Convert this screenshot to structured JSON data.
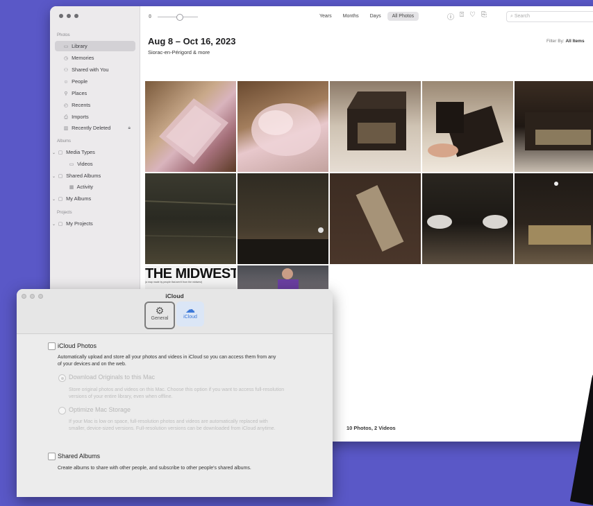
{
  "photos": {
    "sidebar": {
      "sections": {
        "photos": "Photos",
        "albums": "Albums",
        "projects": "Projects"
      },
      "items": [
        {
          "label": "Library",
          "icon": "library-icon",
          "glyph": "▭"
        },
        {
          "label": "Memories",
          "icon": "memories-icon",
          "glyph": "◷"
        },
        {
          "label": "Shared with You",
          "icon": "shared-with-you-icon",
          "glyph": "⚇"
        },
        {
          "label": "People",
          "icon": "people-icon",
          "glyph": "☺"
        },
        {
          "label": "Places",
          "icon": "places-icon",
          "glyph": "⚲"
        },
        {
          "label": "Recents",
          "icon": "recents-icon",
          "glyph": "◴"
        },
        {
          "label": "Imports",
          "icon": "imports-icon",
          "glyph": "⎙"
        },
        {
          "label": "Recently Deleted",
          "icon": "trash-icon",
          "glyph": "▥"
        }
      ],
      "albums": [
        {
          "label": "Media Types",
          "icon": "folder-icon",
          "glyph": "▢"
        },
        {
          "label": "Videos",
          "icon": "videos-icon",
          "glyph": "▭"
        },
        {
          "label": "Shared Albums",
          "icon": "shared-albums-icon",
          "glyph": "▢"
        },
        {
          "label": "Activity",
          "icon": "activity-icon",
          "glyph": "▦"
        },
        {
          "label": "My Albums",
          "icon": "folder-icon",
          "glyph": "▢"
        }
      ],
      "projects": [
        {
          "label": "My Projects",
          "icon": "folder-icon",
          "glyph": "▢"
        }
      ]
    },
    "toolbar": {
      "views": [
        "Years",
        "Months",
        "Days",
        "All Photos"
      ],
      "active_view": "All Photos",
      "search_placeholder": "Search"
    },
    "header": {
      "date_range": "Aug 8 – Oct 16, 2023",
      "location": "Siorac-en-Périgord & more",
      "filter_label": "Filter By:",
      "filter_value": "All Items"
    },
    "photo_subjects": [
      "Box wrapped in pink bubble wrap",
      "Pink bubble wrap unwrapped",
      "Open wooden music box",
      "Hands holding music box lid",
      "Music box mechanism inside",
      "Dark wood lid close-up",
      "Music box side with keyhole",
      "Old paper label on wood",
      "Ornate keyhole escutcheons",
      "Music box cylinder close-up",
      "The Midwest poster",
      "Man in purple shirt"
    ],
    "poster": {
      "headline": "THE MIDWEST:",
      "caption": "(a map made by people that aren't from the midwest)"
    },
    "count": "10 Photos, 2 Videos"
  },
  "icloud": {
    "title": "iCloud",
    "tabs": [
      {
        "label": "General",
        "icon": "gear-icon"
      },
      {
        "label": "iCloud",
        "icon": "cloud-icon"
      }
    ],
    "icloud_photos": {
      "label": "iCloud Photos",
      "description": "Automatically upload and store all your photos and videos in iCloud so you can access them from any of your devices and on the web."
    },
    "download_originals": {
      "label": "Download Originals to this Mac",
      "description": "Store original photos and videos on this Mac. Choose this option if you want to access full-resolution versions of your entire library, even when offline."
    },
    "optimize_storage": {
      "label": "Optimize Mac Storage",
      "description": "If your Mac is low on space, full-resolution photos and videos are automatically replaced with smaller, device-sized versions. Full-resolution versions can be downloaded from iCloud anytime."
    },
    "shared_albums": {
      "label": "Shared Albums",
      "description": "Create albums to share with other people, and subscribe to other people's shared albums."
    }
  }
}
